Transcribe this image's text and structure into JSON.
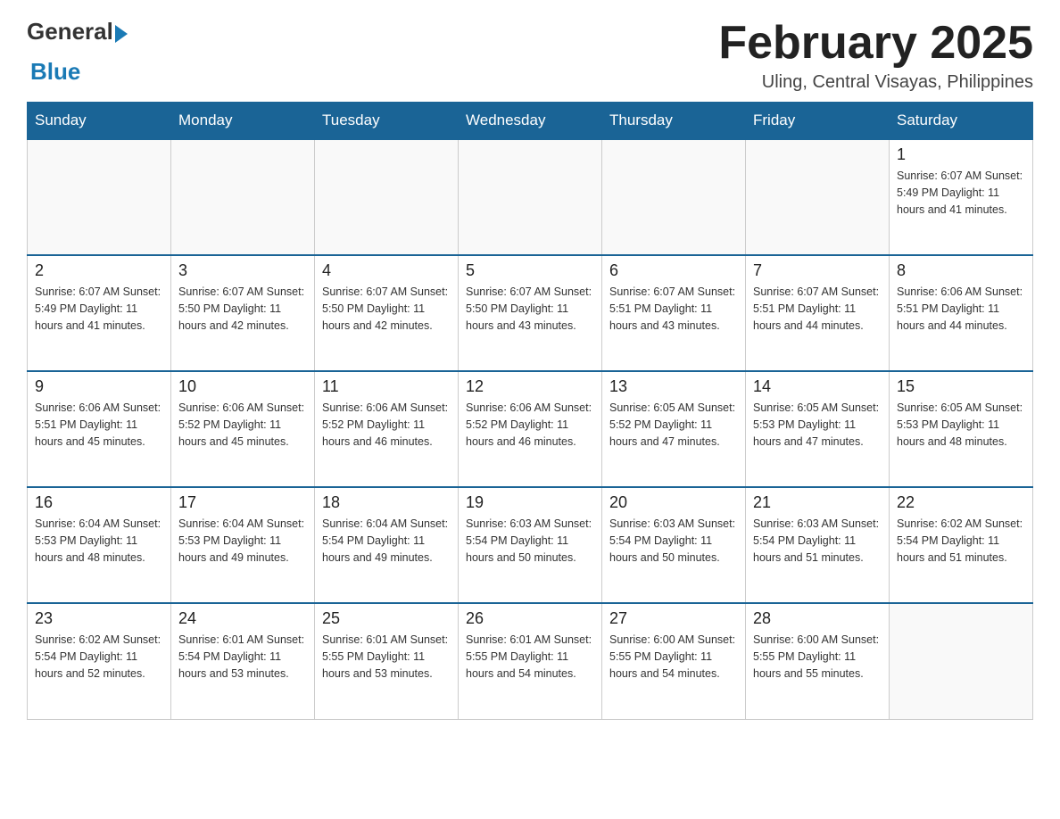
{
  "header": {
    "logo": {
      "text_general": "General",
      "text_blue": "Blue"
    },
    "title": "February 2025",
    "subtitle": "Uling, Central Visayas, Philippines"
  },
  "days_of_week": [
    "Sunday",
    "Monday",
    "Tuesday",
    "Wednesday",
    "Thursday",
    "Friday",
    "Saturday"
  ],
  "weeks": [
    {
      "days": [
        {
          "date": "",
          "info": ""
        },
        {
          "date": "",
          "info": ""
        },
        {
          "date": "",
          "info": ""
        },
        {
          "date": "",
          "info": ""
        },
        {
          "date": "",
          "info": ""
        },
        {
          "date": "",
          "info": ""
        },
        {
          "date": "1",
          "info": "Sunrise: 6:07 AM\nSunset: 5:49 PM\nDaylight: 11 hours and 41 minutes."
        }
      ]
    },
    {
      "days": [
        {
          "date": "2",
          "info": "Sunrise: 6:07 AM\nSunset: 5:49 PM\nDaylight: 11 hours and 41 minutes."
        },
        {
          "date": "3",
          "info": "Sunrise: 6:07 AM\nSunset: 5:50 PM\nDaylight: 11 hours and 42 minutes."
        },
        {
          "date": "4",
          "info": "Sunrise: 6:07 AM\nSunset: 5:50 PM\nDaylight: 11 hours and 42 minutes."
        },
        {
          "date": "5",
          "info": "Sunrise: 6:07 AM\nSunset: 5:50 PM\nDaylight: 11 hours and 43 minutes."
        },
        {
          "date": "6",
          "info": "Sunrise: 6:07 AM\nSunset: 5:51 PM\nDaylight: 11 hours and 43 minutes."
        },
        {
          "date": "7",
          "info": "Sunrise: 6:07 AM\nSunset: 5:51 PM\nDaylight: 11 hours and 44 minutes."
        },
        {
          "date": "8",
          "info": "Sunrise: 6:06 AM\nSunset: 5:51 PM\nDaylight: 11 hours and 44 minutes."
        }
      ]
    },
    {
      "days": [
        {
          "date": "9",
          "info": "Sunrise: 6:06 AM\nSunset: 5:51 PM\nDaylight: 11 hours and 45 minutes."
        },
        {
          "date": "10",
          "info": "Sunrise: 6:06 AM\nSunset: 5:52 PM\nDaylight: 11 hours and 45 minutes."
        },
        {
          "date": "11",
          "info": "Sunrise: 6:06 AM\nSunset: 5:52 PM\nDaylight: 11 hours and 46 minutes."
        },
        {
          "date": "12",
          "info": "Sunrise: 6:06 AM\nSunset: 5:52 PM\nDaylight: 11 hours and 46 minutes."
        },
        {
          "date": "13",
          "info": "Sunrise: 6:05 AM\nSunset: 5:52 PM\nDaylight: 11 hours and 47 minutes."
        },
        {
          "date": "14",
          "info": "Sunrise: 6:05 AM\nSunset: 5:53 PM\nDaylight: 11 hours and 47 minutes."
        },
        {
          "date": "15",
          "info": "Sunrise: 6:05 AM\nSunset: 5:53 PM\nDaylight: 11 hours and 48 minutes."
        }
      ]
    },
    {
      "days": [
        {
          "date": "16",
          "info": "Sunrise: 6:04 AM\nSunset: 5:53 PM\nDaylight: 11 hours and 48 minutes."
        },
        {
          "date": "17",
          "info": "Sunrise: 6:04 AM\nSunset: 5:53 PM\nDaylight: 11 hours and 49 minutes."
        },
        {
          "date": "18",
          "info": "Sunrise: 6:04 AM\nSunset: 5:54 PM\nDaylight: 11 hours and 49 minutes."
        },
        {
          "date": "19",
          "info": "Sunrise: 6:03 AM\nSunset: 5:54 PM\nDaylight: 11 hours and 50 minutes."
        },
        {
          "date": "20",
          "info": "Sunrise: 6:03 AM\nSunset: 5:54 PM\nDaylight: 11 hours and 50 minutes."
        },
        {
          "date": "21",
          "info": "Sunrise: 6:03 AM\nSunset: 5:54 PM\nDaylight: 11 hours and 51 minutes."
        },
        {
          "date": "22",
          "info": "Sunrise: 6:02 AM\nSunset: 5:54 PM\nDaylight: 11 hours and 51 minutes."
        }
      ]
    },
    {
      "days": [
        {
          "date": "23",
          "info": "Sunrise: 6:02 AM\nSunset: 5:54 PM\nDaylight: 11 hours and 52 minutes."
        },
        {
          "date": "24",
          "info": "Sunrise: 6:01 AM\nSunset: 5:54 PM\nDaylight: 11 hours and 53 minutes."
        },
        {
          "date": "25",
          "info": "Sunrise: 6:01 AM\nSunset: 5:55 PM\nDaylight: 11 hours and 53 minutes."
        },
        {
          "date": "26",
          "info": "Sunrise: 6:01 AM\nSunset: 5:55 PM\nDaylight: 11 hours and 54 minutes."
        },
        {
          "date": "27",
          "info": "Sunrise: 6:00 AM\nSunset: 5:55 PM\nDaylight: 11 hours and 54 minutes."
        },
        {
          "date": "28",
          "info": "Sunrise: 6:00 AM\nSunset: 5:55 PM\nDaylight: 11 hours and 55 minutes."
        },
        {
          "date": "",
          "info": ""
        }
      ]
    }
  ]
}
